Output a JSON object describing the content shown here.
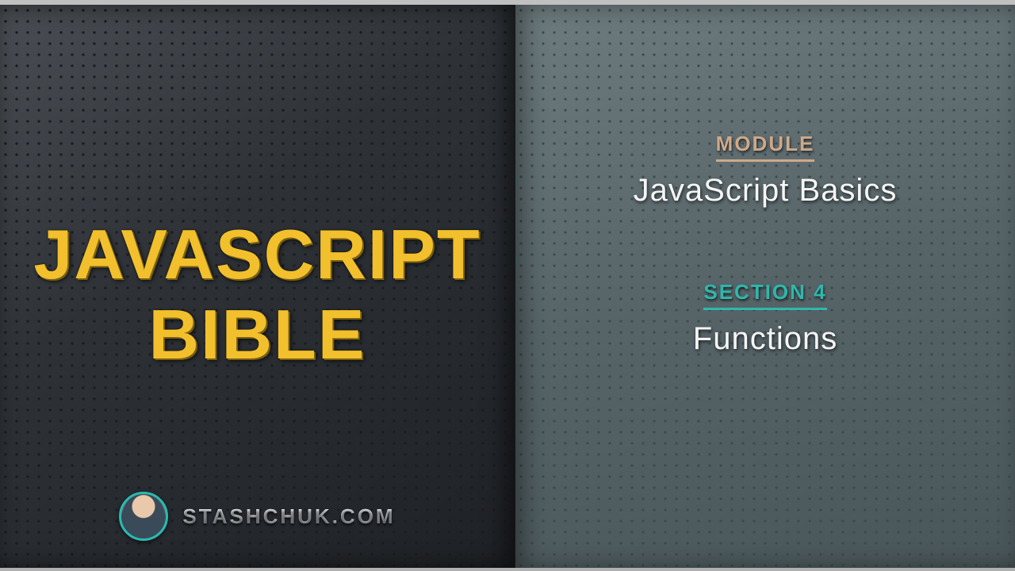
{
  "title": {
    "line1": "JAVASCRIPT",
    "line2": "BIBLE"
  },
  "site": "STASHCHUK.COM",
  "module": {
    "label": "MODULE",
    "value": "JavaScript Basics"
  },
  "section": {
    "label": "SECTION 4",
    "value": "Functions"
  }
}
